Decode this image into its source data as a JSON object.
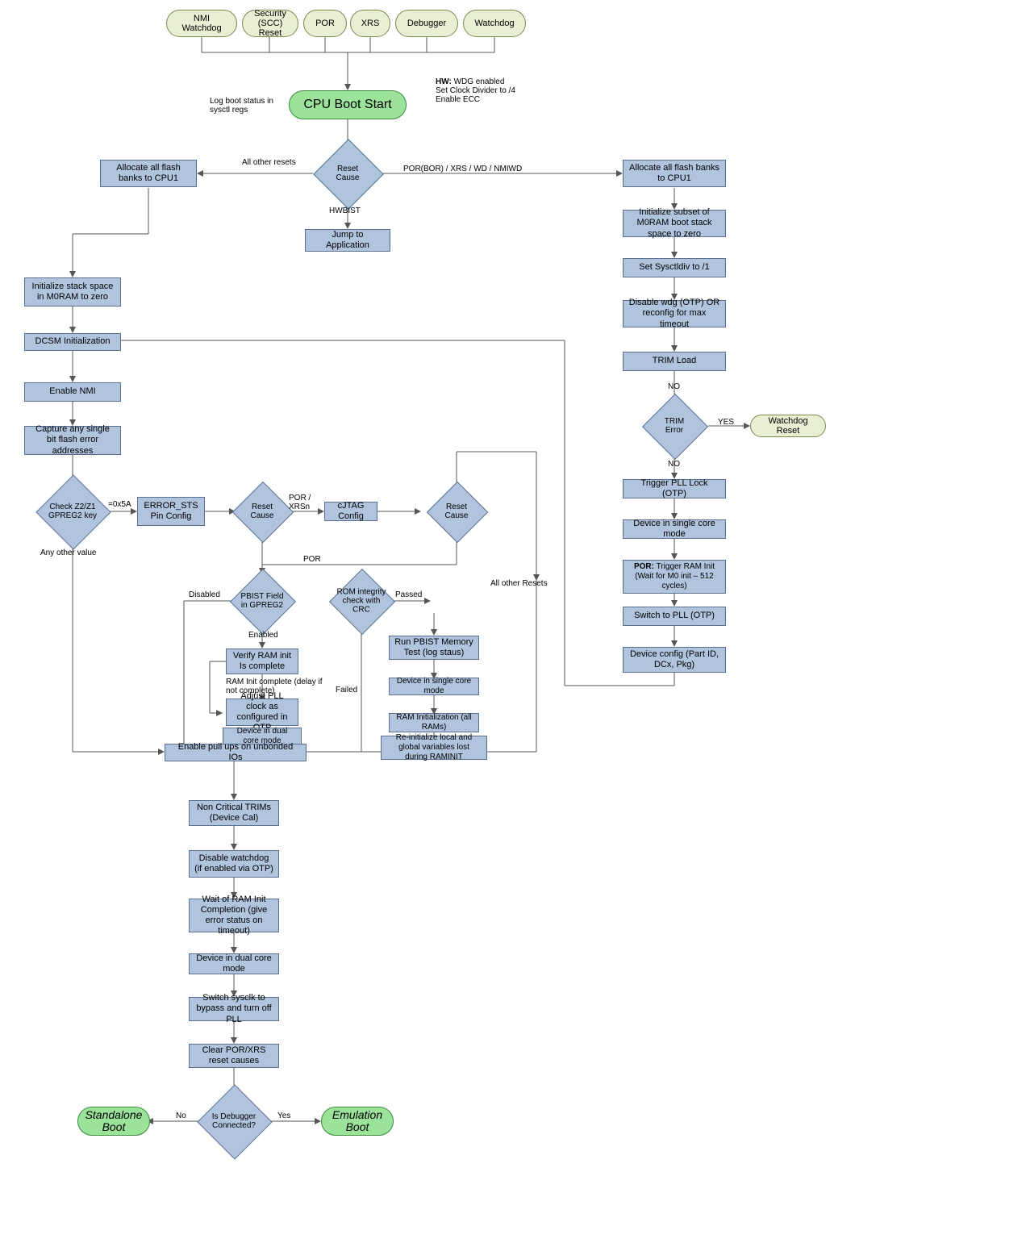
{
  "sources": {
    "nmi": "NMI Watchdog",
    "scc": "Security (SCC) Reset",
    "por": "POR",
    "xrs": "XRS",
    "dbg": "Debugger",
    "wdg": "Watchdog"
  },
  "start": "CPU Boot Start",
  "hw_note_title": "HW:",
  "hw_note": "WDG enabled\nSet Clock Divider to /4\nEnable ECC",
  "log_note": "Log boot status in sysctl regs",
  "reset_cause": "Reset Cause",
  "edge_other": "All other resets",
  "edge_por_xrs_wd": "POR(BOR) / XRS / WD / NMIWD",
  "edge_hwbist": "HWBIST",
  "jump_app": "Jump to Application",
  "l_alloc": "Allocate all flash banks to CPU1",
  "l_stack": "Initialize stack space in M0RAM to zero",
  "l_dcsm": "DCSM Initialization",
  "l_nmi": "Enable NMI",
  "l_cap": "Capture any single bit flash error addresses",
  "l_check_key": "Check Z2/Z1 GPREG2 key",
  "edge_0x5a": "=0x5A",
  "edge_anyother": "Any other value",
  "errsts": "ERROR_STS Pin Config",
  "reset_cause2": "Reset Cause",
  "edge_porxrsn": "POR / XRSn",
  "edge_por": "POR",
  "cjtag": "cJTAG Config",
  "reset_cause3": "Reset Cause",
  "edge_allother": "All other Resets",
  "pbist_field": "PBIST Field in GPREG2",
  "edge_disabled": "Disabled",
  "edge_enabled": "Enabled",
  "verify_ram": "Verify RAM init Is complete",
  "ram_init_note": "RAM Init complete (delay if not complete)",
  "adj_pll": "Adjust PLL clock as configured in OTP",
  "dual_core": "Device in dual core mode",
  "rom_crc": "ROM integrity check with CRC",
  "edge_passed": "Passed",
  "edge_failed": "Failed",
  "run_pbist": "Run PBIST Memory Test (log staus)",
  "single_core": "Device in single core mode",
  "ram_all": "RAM Initialization (all RAMs)",
  "reinit": "Re-initialize local and global variables lost during RAMINIT",
  "pullups": "Enable pull ups on unbonded IOs",
  "nc_trim": "Non Critical TRIMs (Device Cal)",
  "dis_wdg": "Disable watchdog (if enabled via OTP)",
  "wait_ram": "Wait of RAM Init Completion (give error status on timeout)",
  "dual_core2": "Device in dual core mode",
  "switch_bypass": "Switch sysclk to bypass and turn off PLL",
  "clear_por": "Clear POR/XRS reset causes",
  "is_dbg": "Is Debugger Connected?",
  "standalone": "Standalone Boot",
  "emulation": "Emulation Boot",
  "no": "No",
  "yes": "Yes",
  "r_alloc": "Allocate all flash banks to CPU1",
  "r_initm0": "Initialize subset of M0RAM boot stack space to zero",
  "r_sysdiv": "Set Sysctldiv to /1",
  "r_diswdg": "Disable wdg (OTP) OR reconfig for max timeout",
  "r_trimload": "TRIM Load",
  "r_trimerr": "TRIM Error",
  "r_wdgreset": "Watchdog Reset",
  "YES": "YES",
  "NO": "NO",
  "r_pll": "Trigger PLL Lock (OTP)",
  "r_single": "Device in single core mode",
  "r_porinit_pre": "POR:",
  "r_porinit": "Trigger RAM Init (Wait for M0 init – 512 cycles)",
  "r_switchpll": "Switch to PLL (OTP)",
  "r_devcfg": "Device config (Part ID, DCx, Pkg)"
}
